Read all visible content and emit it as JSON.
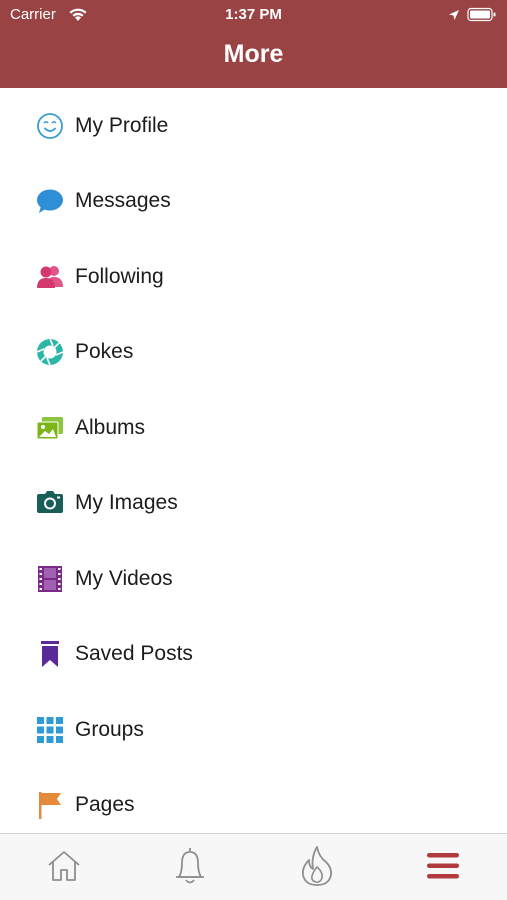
{
  "status_bar": {
    "carrier": "Carrier",
    "time": "1:37 PM"
  },
  "header": {
    "title": "More",
    "background_color": "#994345"
  },
  "menu": {
    "items": [
      {
        "label": "My Profile",
        "icon": "smiley-face-icon",
        "color": "#3a9bd5"
      },
      {
        "label": "Messages",
        "icon": "speech-bubble-icon",
        "color": "#2e8fd6"
      },
      {
        "label": "Following",
        "icon": "people-icon",
        "color": "#d4386f"
      },
      {
        "label": "Pokes",
        "icon": "aperture-icon",
        "color": "#2bb6a7"
      },
      {
        "label": "Albums",
        "icon": "photos-icon",
        "color": "#7cb518"
      },
      {
        "label": "My Images",
        "icon": "camera-icon",
        "color": "#1a5e5a"
      },
      {
        "label": "My Videos",
        "icon": "film-strip-icon",
        "color": "#7b2a8a"
      },
      {
        "label": "Saved Posts",
        "icon": "bookmark-icon",
        "color": "#5b2a9a"
      },
      {
        "label": "Groups",
        "icon": "grid-icon",
        "color": "#2e9ad6"
      },
      {
        "label": "Pages",
        "icon": "flag-icon",
        "color": "#e58a3a"
      }
    ]
  },
  "tab_bar": {
    "tabs": [
      {
        "name": "home",
        "icon": "home-icon"
      },
      {
        "name": "notifications",
        "icon": "bell-icon"
      },
      {
        "name": "trending",
        "icon": "flame-icon"
      },
      {
        "name": "more",
        "icon": "hamburger-menu-icon",
        "active": true,
        "color": "#b03a3e"
      }
    ]
  }
}
